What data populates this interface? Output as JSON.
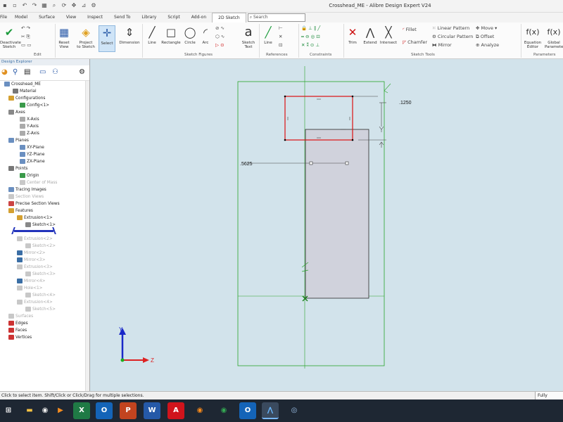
{
  "window": {
    "title": "Crosshead_ME - Alibre Design Expert V24"
  },
  "menu": {
    "items": [
      "File",
      "Model",
      "Surface",
      "View",
      "Inspect",
      "Send To",
      "Library",
      "Script",
      "Add-on",
      "2D Sketch"
    ],
    "active": "2D Sketch",
    "search_placeholder": "Search"
  },
  "ribbon": {
    "tools": {
      "deactivate": "Deactivate\nSketch",
      "reset": "Reset\nView",
      "project": "Project\nto Sketch",
      "select": "Select",
      "dimension": "Dimension",
      "line": "Line",
      "rectangle": "Rectangle",
      "circle": "Circle",
      "arc": "Arc",
      "sketch_text": "Sketch\nText",
      "ref_line": "Line",
      "trim": "Trim",
      "extend": "Extend",
      "intersect": "Intersect",
      "fillet": "Fillet",
      "chamfer": "Chamfer",
      "linear_pattern": "Linear Pattern",
      "circular_pattern": "Circular Pattern",
      "mirror": "Mirror",
      "move": "Move",
      "offset": "Offset",
      "analyze": "Analyze",
      "equation": "Equation\nEditor",
      "global": "Global\nParameters"
    },
    "groups": [
      "Edit",
      "Sketch Figures",
      "References",
      "Constraints",
      "Sketch Tools",
      "Parameters"
    ]
  },
  "panel": {
    "title": "Design Explorer"
  },
  "tree": [
    {
      "label": "Crosshead_ME",
      "dim": false
    },
    {
      "label": "Material",
      "dim": false
    },
    {
      "label": "Configurations",
      "dim": false
    },
    {
      "label": "Config<1>",
      "dim": false
    },
    {
      "label": "Axes",
      "dim": false
    },
    {
      "label": "X-Axis",
      "dim": false
    },
    {
      "label": "Y-Axis",
      "dim": false
    },
    {
      "label": "Z-Axis",
      "dim": false
    },
    {
      "label": "Planes",
      "dim": false
    },
    {
      "label": "XY-Plane",
      "dim": false
    },
    {
      "label": "YZ-Plane",
      "dim": false
    },
    {
      "label": "ZX-Plane",
      "dim": false
    },
    {
      "label": "Points",
      "dim": false
    },
    {
      "label": "Origin",
      "dim": false
    },
    {
      "label": "Center of Mass",
      "dim": true
    },
    {
      "label": "Tracing Images",
      "dim": false
    },
    {
      "label": "Section Views",
      "dim": true
    },
    {
      "label": "Precise Section Views",
      "dim": false
    },
    {
      "label": "Features",
      "dim": false
    },
    {
      "label": "Extrusion<1>",
      "dim": false
    },
    {
      "label": "Sketch<1>",
      "dim": false
    },
    {
      "label": "Extrusion<2>",
      "dim": true
    },
    {
      "label": "Sketch<2>",
      "dim": true
    },
    {
      "label": "Mirror<2>",
      "dim": true
    },
    {
      "label": "Mirror<3>",
      "dim": true
    },
    {
      "label": "Extrusion<3>",
      "dim": true
    },
    {
      "label": "Sketch<3>",
      "dim": true
    },
    {
      "label": "Mirror<4>",
      "dim": true
    },
    {
      "label": "Hole<1>",
      "dim": true
    },
    {
      "label": "Sketch<4>",
      "dim": true
    },
    {
      "label": "Extrusion<4>",
      "dim": true
    },
    {
      "label": "Sketch<5>",
      "dim": true
    },
    {
      "label": "Surfaces",
      "dim": true
    },
    {
      "label": "Edges",
      "dim": false
    },
    {
      "label": "Faces",
      "dim": false
    },
    {
      "label": "Vertices",
      "dim": false
    }
  ],
  "sketch": {
    "dim_top": ".1250",
    "dim_left": ".5625"
  },
  "triad": {
    "y": "Y",
    "z": "Z"
  },
  "status": {
    "message": "Click to select item. Shift/Click or Click/Drag for multiple selections.",
    "right": "Fully Defined"
  },
  "taskbar": {
    "apps": [
      "start",
      "explorer",
      "chrome",
      "media",
      "excel",
      "outlook",
      "powerpoint",
      "word",
      "acrobat",
      "firefox",
      "chrome2",
      "outlook2",
      "alibre",
      "tool"
    ]
  }
}
